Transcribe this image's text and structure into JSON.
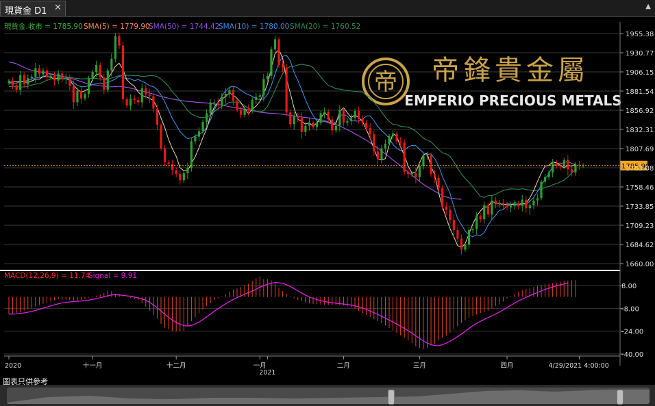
{
  "tab": {
    "label": "現貨金 D1",
    "close": "✕"
  },
  "window": {
    "caret": "▲"
  },
  "legend": {
    "price": "現貨金.收市 = 1785.90",
    "sma5": "SMA(5) = 1779.90",
    "sma50": "SMA(50) = 1744.42",
    "sma10": "SMA(10) = 1780.00",
    "sma20": "SMA(20) = 1760.52",
    "macd": "MACD(12,26,9) = 11.74",
    "signal": "Signal = 9.91"
  },
  "logo": {
    "cn": "帝鋒貴金屬",
    "en": "EMPERIO PRECIOUS METALS"
  },
  "disclaimer": "圖表只供參考",
  "colors": {
    "up": "#2ea02e",
    "down": "#e81818",
    "grid": "#3a3a3a",
    "price_legend": "#3cb43c",
    "sma5": "#ff8a5c",
    "sma50": "#9b4fd8",
    "sma10": "#3d8ee0",
    "sma20": "#2e8b57",
    "macd_label": "#ff3030",
    "signal": "#e020e0",
    "macd_bar": "#e8451c",
    "current": "#f5a623",
    "logo_gold": "#c9a24a"
  },
  "chart_data": [
    {
      "type": "candlestick",
      "title": "現貨金 D1",
      "last_price": "1785.90",
      "ylim": [
        1660.0,
        1955.38
      ],
      "yticks": [
        "1955.38",
        "1930.77",
        "1906.15",
        "1881.54",
        "1856.92",
        "1832.31",
        "1807.69",
        "1783.08",
        "1758.46",
        "1733.85",
        "1709.23",
        "1684.62",
        "1660.00"
      ],
      "xticks": [
        {
          "label": "2020",
          "idx": 0
        },
        {
          "label": "十一月",
          "idx": 22
        },
        {
          "label": "十二月",
          "idx": 44
        },
        {
          "label": "一月",
          "idx": 66
        },
        {
          "label": "2021",
          "idx": 68
        },
        {
          "label": "二月",
          "idx": 88
        },
        {
          "label": "三月",
          "idx": 108
        },
        {
          "label": "四月",
          "idx": 131
        },
        {
          "label": "4/29/2021 4:00:00",
          "idx": 150
        }
      ],
      "close": [
        1895,
        1889,
        1883,
        1902,
        1890,
        1898,
        1900,
        1911,
        1903,
        1908,
        1900,
        1901,
        1895,
        1904,
        1897,
        1898,
        1888,
        1867,
        1882,
        1872,
        1878,
        1897,
        1906,
        1915,
        1899,
        1883,
        1908,
        1923,
        1952,
        1940,
        1871,
        1863,
        1872,
        1870,
        1867,
        1885,
        1877,
        1875,
        1859,
        1838,
        1808,
        1790,
        1788,
        1780,
        1775,
        1767,
        1776,
        1783,
        1817,
        1823,
        1830,
        1842,
        1853,
        1867,
        1867,
        1864,
        1874,
        1878,
        1883,
        1869,
        1857,
        1851,
        1859,
        1857,
        1870,
        1874,
        1876,
        1897,
        1901,
        1935,
        1948,
        1915,
        1912,
        1854,
        1839,
        1849,
        1847,
        1829,
        1837,
        1841,
        1835,
        1841,
        1853,
        1855,
        1845,
        1831,
        1837,
        1857,
        1841,
        1843,
        1847,
        1856,
        1846,
        1841,
        1834,
        1826,
        1804,
        1794,
        1808,
        1814,
        1824,
        1827,
        1817,
        1816,
        1778,
        1775,
        1776,
        1771,
        1785,
        1799,
        1799,
        1775,
        1770,
        1757,
        1733,
        1729,
        1716,
        1703,
        1692,
        1678,
        1684,
        1703,
        1704,
        1721,
        1717,
        1735,
        1723,
        1741,
        1736,
        1738,
        1736,
        1732,
        1734,
        1737,
        1734,
        1742,
        1731,
        1735,
        1741,
        1744,
        1765,
        1771,
        1777,
        1789,
        1786,
        1785,
        1793,
        1781,
        1777,
        1787,
        1786,
        1786
      ],
      "sma5": [
        1892.7,
        1893.1,
        1894.0,
        1893.7,
        1893.1,
        1892.6,
        1894.3,
        1896.8,
        1896.8,
        1900.2,
        1900.2,
        1899.2,
        1897.1,
        1897.6,
        1897.2,
        1897.5,
        1895.3,
        1889.2,
        1883.7,
        1880.2,
        1881.9,
        1884.7,
        1896.6,
        1903.0,
        1903.7,
        1896.5,
        1898.0,
        1904.6,
        1913.2,
        1917.3,
        1909.5,
        1896.1,
        1891.2,
        1887.6,
        1880.3,
        1875.8,
        1874.3,
        1872.1,
        1869.4,
        1860.4,
        1847.0,
        1834.6,
        1819.1,
        1807.2,
        1797.8,
        1783.0,
        1779.3,
        1779.0,
        1788.8,
        1797.1,
        1808.9,
        1821.7,
        1833.1,
        1849.6,
        1860.6,
        1867.5,
        1871.0,
        1874.7,
        1879.1,
        1876.4,
        1872.2,
        1866.5,
        1859.2,
        1852.6,
        1858.0,
        1862.4,
        1868.2,
        1878.2,
        1890.3,
        1910.8,
        1929.7,
        1934.8,
        1923.5,
        1897.3,
        1878.9,
        1859.3,
        1845.6,
        1842.4,
        1839.1,
        1841.0,
        1836.0,
        1841.0,
        1846.7,
        1853.7,
        1849.6,
        1838.2,
        1839.8,
        1854.9,
        1860.3,
        1853.9,
        1847.5,
        1850.9,
        1847.2,
        1842.7,
        1832.0,
        1821.1,
        1807.3,
        1794.7,
        1792.9,
        1794.8,
        1811.8,
        1827.2,
        1823.3,
        1810.0,
        1798.6,
        1785.2,
        1776.0,
        1777.7,
        1789.5,
        1799.5,
        1801.7,
        1784.9,
        1773.8,
        1751.3,
        1733.2,
        1718.5,
        1705.1,
        1694.4,
        1683.2,
        1680.6,
        1685.5,
        1698.3,
        1710.8,
        1720.9,
        1727.7,
        1732.5,
        1733.0,
        1740.3,
        1737.5,
        1737.4,
        1735.5,
        1736.6,
        1736.2,
        1736.0,
        1735.4,
        1737.3,
        1736.8,
        1744.6,
        1753.6,
        1765.2,
        1776.1,
        1785.1,
        1785.9,
        1790.5,
        1789.5,
        1786.0,
        1783.2,
        1786.1,
        1785.0,
        1787.7
      ],
      "sma10": [
        1891.0,
        1891.3,
        1891.9,
        1893.6,
        1893.9,
        1895.4,
        1896.9,
        1898.5,
        1898.6,
        1900.4,
        1901.7,
        1902.6,
        1901.9,
        1901.8,
        1900.7,
        1899.1,
        1896.6,
        1892.4,
        1889.0,
        1887.1,
        1887.2,
        1888.6,
        1889.7,
        1891.3,
        1891.8,
        1891.5,
        1892.4,
        1894.7,
        1896.9,
        1900.6,
        1899.0,
        1897.3,
        1897.3,
        1894.8,
        1896.4,
        1893.9,
        1891.9,
        1888.4,
        1887.3,
        1883.6,
        1876.3,
        1867.6,
        1857.0,
        1845.9,
        1838.0,
        1829.4,
        1824.5,
        1820.4,
        1821.4,
        1823.8,
        1826.1,
        1828.7,
        1834.6,
        1844.2,
        1857.1,
        1866.7,
        1875.2,
        1881.6,
        1886.5,
        1887.7,
        1886.2,
        1882.6,
        1879.2,
        1876.9,
        1874.7,
        1871.9,
        1870.7,
        1871.3,
        1877.0,
        1888.5,
        1903.7,
        1917.6,
        1926.2,
        1927.3,
        1920.5,
        1905.4,
        1895.0,
        1883.3,
        1870.4,
        1859.3,
        1850.0,
        1843.4,
        1841.4,
        1842.7,
        1840.7,
        1839.3,
        1841.9,
        1850.2,
        1851.3,
        1849.6,
        1843.4,
        1843.2,
        1842.9,
        1845.5,
        1849.5,
        1849.6,
        1843.8,
        1836.3,
        1830.7,
        1826.4,
        1821.0,
        1812.9,
        1808.0,
        1805.1,
        1805.7,
        1809.5,
        1811.8,
        1811.5,
        1806.7,
        1802.2,
        1800.2,
        1800.8,
        1794.7,
        1785.5,
        1771.9,
        1760.9,
        1750.4,
        1732.6,
        1717.8,
        1710.1,
        1701.8,
        1696.3,
        1694.6,
        1697.0,
        1696.0,
        1700.0,
        1709.3,
        1716.5,
        1722.0,
        1728.4,
        1729.1,
        1734.3,
        1734.5,
        1738.7,
        1736.5,
        1737.0,
        1735.9,
        1740.2,
        1744.9,
        1752.2,
        1760.0,
        1768.6,
        1775.4,
        1784.2,
        1788.8,
        1788.3,
        1789.5,
        1791.3,
        1788.7,
        1787.6
      ],
      "sma20": [
        1887.2,
        1887.6,
        1887.3,
        1886.8,
        1886.8,
        1887.7,
        1889.3,
        1890.4,
        1891.1,
        1893.2,
        1895.3,
        1896.8,
        1897.7,
        1898.5,
        1899.1,
        1899.6,
        1899.3,
        1898.3,
        1897.7,
        1897.2,
        1897.2,
        1897.6,
        1897.5,
        1897.8,
        1897.2,
        1896.4,
        1896.8,
        1898.2,
        1899.8,
        1901.4,
        1901.8,
        1901.7,
        1901.8,
        1901.1,
        1901.2,
        1900.2,
        1900.6,
        1901.3,
        1901.3,
        1900.1,
        1897.0,
        1892.7,
        1887.4,
        1880.5,
        1875.4,
        1869.1,
        1863.3,
        1856.7,
        1852.2,
        1849.7,
        1847.9,
        1847.7,
        1848.0,
        1850.6,
        1855.1,
        1858.7,
        1862.3,
        1864.3,
        1866.9,
        1867.6,
        1867.1,
        1865.9,
        1862.7,
        1859.6,
        1857.5,
        1855.7,
        1855.1,
        1856.2,
        1862.1,
        1871.7,
        1882.9,
        1894.0,
        1903.9,
        1910.1,
        1913.0,
        1913.5,
        1914.9,
        1916.0,
        1915.0,
        1914.2,
        1911.7,
        1906.0,
        1899.8,
        1893.9,
        1888.9,
        1887.0,
        1884.4,
        1884.1,
        1883.0,
        1882.6,
        1881.7,
        1881.0,
        1880.6,
        1880.4,
        1875.9,
        1873.3,
        1867.4,
        1861.7,
        1854.7,
        1848.0,
        1842.6,
        1838.8,
        1838.1,
        1836.4,
        1835.7,
        1835.1,
        1833.1,
        1830.0,
        1825.7,
        1821.0,
        1818.4,
        1816.4,
        1811.4,
        1806.6,
        1802.4,
        1800.6,
        1797.8,
        1790.7,
        1782.3,
        1775.4,
        1769.4,
        1764.3,
        1758.6,
        1752.3,
        1746.4,
        1745.0,
        1747.2,
        1747.6,
        1748.9,
        1751.5,
        1753.8,
        1755.1,
        1756.0,
        1755.7,
        1755.4,
        1756.1,
        1755.3,
        1754.3,
        1753.9,
        1754.2,
        1755.8,
        1757.7,
        1759.0,
        1761.2,
        1762.8,
        1764.9,
        1767.3,
        1771.4,
        1776.2,
        1781.0
      ],
      "sma50": [
        1919.0,
        1918.0,
        1916.5,
        1914.2,
        1911.9,
        1909.8,
        1908.2,
        1907.1,
        1906.3,
        1905.6,
        1904.5,
        1903.6,
        1902.5,
        1901.3,
        1900.4,
        1899.6,
        1898.3,
        1896.7,
        1895.4,
        1893.7,
        1892.1,
        1890.6,
        1889.7,
        1889.1,
        1888.3,
        1887.6,
        1887.1,
        1887.0,
        1887.3,
        1887.5,
        1887.0,
        1886.3,
        1885.4,
        1884.1,
        1882.7,
        1881.6,
        1880.3,
        1879.0,
        1877.5,
        1876.0,
        1874.6,
        1873.5,
        1872.4,
        1871.3,
        1870.5,
        1869.6,
        1868.9,
        1868.3,
        1867.9,
        1867.4,
        1866.9,
        1866.6,
        1866.2,
        1865.5,
        1864.9,
        1864.1,
        1863.4,
        1862.5,
        1861.5,
        1860.5,
        1859.8,
        1859.0,
        1858.2,
        1857.3,
        1856.3,
        1855.4,
        1854.4,
        1853.8,
        1853.3,
        1853.0,
        1852.7,
        1852.3,
        1851.7,
        1851.0,
        1850.3,
        1849.5,
        1848.8,
        1848.2,
        1847.6,
        1847.1,
        1846.3,
        1845.6,
        1844.7,
        1843.6,
        1842.1,
        1840.4,
        1838.6,
        1836.6,
        1834.3,
        1831.9,
        1829.4,
        1826.8,
        1824.1,
        1821.2,
        1818.3,
        1815.0,
        1811.7,
        1808.1,
        1804.5,
        1800.8,
        1797.0,
        1793.1,
        1789.3,
        1785.5,
        1781.5,
        1777.4,
        1773.5,
        1769.5,
        1765.5,
        1761.9,
        1758.7,
        1755.8,
        1752.9,
        1750.2,
        1747.6,
        1745.5,
        1744.1,
        1743.2,
        1742.9,
        1742.6
      ],
      "sma50_start": 101,
      "current_line": 1785.9
    },
    {
      "type": "bar",
      "title": "MACD(12,26,9)",
      "ylim": [
        -40.0,
        8.0
      ],
      "yticks": [
        "8.00",
        "-8.00",
        "-24.00",
        "-40.00"
      ],
      "macd": [
        -12.0,
        -11.6,
        -11.2,
        -10.5,
        -9.5,
        -8.5,
        -7.7,
        -6.9,
        -5.5,
        -4.8,
        -4.0,
        -3.4,
        -2.5,
        -1.6,
        -1.8,
        -2.0,
        -2.3,
        -2.7,
        -2.6,
        -2.1,
        -1.3,
        -0.5,
        0.3,
        0.9,
        1.7,
        2.8,
        4.5,
        4.0,
        2.3,
        1.2,
        0.6,
        0.3,
        -0.8,
        -1.6,
        -2.4,
        -4.5,
        -6.8,
        -9.6,
        -12.8,
        -15.3,
        -18.8,
        -21.7,
        -22.6,
        -24.0,
        -24.3,
        -24.3,
        -23.9,
        -20.4,
        -17.0,
        -14.2,
        -11.5,
        -9.0,
        -6.3,
        -4.4,
        -2.2,
        -0.8,
        0.2,
        1.7,
        3.6,
        5.2,
        5.9,
        6.8,
        8.0,
        9.1,
        11.3,
        13.0,
        14.3,
        12.3,
        12.3,
        11.6,
        9.6,
        6.5,
        4.1,
        2.2,
        0.4,
        -1.0,
        -2.2,
        -3.1,
        -4.0,
        -4.6,
        -4.9,
        -5.2,
        -5.4,
        -5.5,
        -5.6,
        -5.7,
        -5.8,
        -5.9,
        -6.0,
        -6.5,
        -7.4,
        -8.5,
        -9.8,
        -11.2,
        -12.7,
        -14.1,
        -15.5,
        -17.0,
        -18.5,
        -20.0,
        -21.7,
        -23.4,
        -25.1,
        -27.0,
        -28.7,
        -30.5,
        -32.4,
        -34.6,
        -35.7,
        -36.8,
        -35.6,
        -34.1,
        -32.8,
        -30.6,
        -28.5,
        -27.2,
        -25.3,
        -22.7,
        -20.6,
        -18.2,
        -16.4,
        -14.7,
        -13.4,
        -12.3,
        -11.4,
        -10.7,
        -9.6,
        -8.1,
        -6.3,
        -5.2,
        -3.2,
        -1.2,
        0.6,
        1.9,
        3.5,
        4.6,
        5.4,
        6.2,
        7.0,
        7.8,
        8.4,
        8.9,
        9.3,
        9.7,
        10.1,
        10.6,
        11.0,
        11.3,
        11.6,
        11.74
      ],
      "signal": [
        -12.0,
        -12.0,
        -11.9,
        -11.6,
        -11.2,
        -10.7,
        -10.1,
        -9.5,
        -8.7,
        -7.9,
        -7.1,
        -6.3,
        -5.5,
        -4.8,
        -4.2,
        -3.8,
        -3.5,
        -3.3,
        -3.1,
        -2.9,
        -2.6,
        -2.2,
        -1.7,
        -1.2,
        -0.6,
        0.1,
        0.8,
        1.4,
        1.6,
        1.4,
        1.1,
        0.8,
        0.4,
        -0.1,
        -0.6,
        -1.4,
        -2.3,
        -3.8,
        -5.6,
        -7.6,
        -9.9,
        -12.2,
        -14.3,
        -16.2,
        -17.9,
        -19.2,
        -20.1,
        -20.4,
        -20.0,
        -18.9,
        -17.6,
        -15.9,
        -14.0,
        -12.1,
        -10.1,
        -8.2,
        -6.5,
        -4.8,
        -3.2,
        -1.8,
        -0.5,
        0.7,
        1.9,
        3.0,
        4.1,
        5.4,
        6.8,
        8.0,
        8.8,
        9.6,
        10.1,
        9.9,
        9.5,
        8.6,
        7.3,
        5.8,
        4.2,
        2.7,
        1.3,
        0.0,
        -1.0,
        -1.9,
        -2.6,
        -3.2,
        -3.7,
        -4.1,
        -4.4,
        -4.7,
        -5.0,
        -5.3,
        -5.7,
        -6.2,
        -6.9,
        -7.8,
        -8.8,
        -9.9,
        -11.1,
        -12.3,
        -13.6,
        -14.9,
        -16.2,
        -17.6,
        -19.0,
        -20.5,
        -22.0,
        -23.7,
        -25.4,
        -27.3,
        -29.1,
        -30.9,
        -32.3,
        -33.4,
        -34.1,
        -34.2,
        -33.5,
        -32.4,
        -31.1,
        -29.6,
        -27.8,
        -26.0,
        -24.1,
        -22.1,
        -20.2,
        -18.6,
        -17.1,
        -15.8,
        -14.5,
        -13.3,
        -12.0,
        -10.6,
        -9.1,
        -7.5,
        -5.9,
        -4.3,
        -2.8,
        -1.5,
        -0.3,
        0.9,
        2.0,
        3.1,
        4.2,
        5.2,
        6.1,
        7.0,
        7.9,
        8.5,
        9.1,
        9.91
      ]
    }
  ]
}
